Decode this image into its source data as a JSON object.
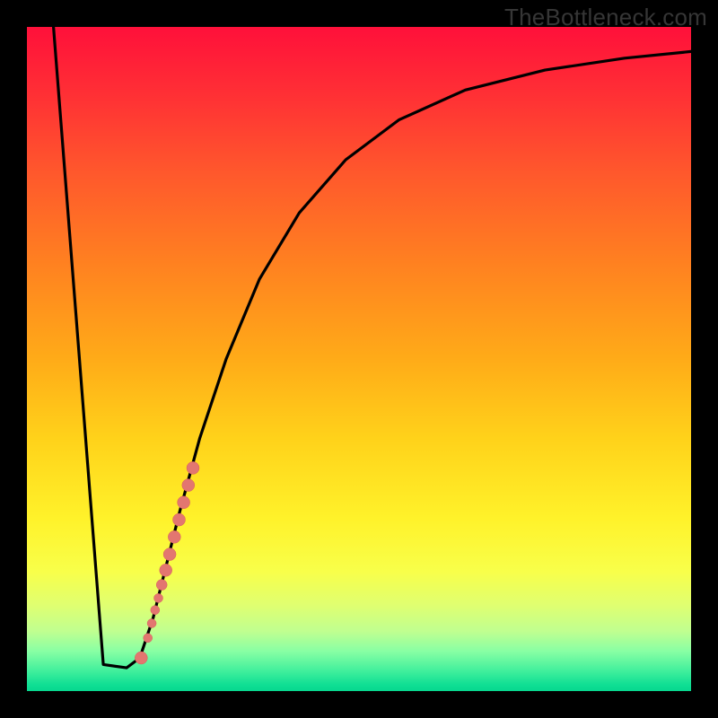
{
  "watermark": "TheBottleneck.com",
  "chart_data": {
    "type": "line",
    "title": "",
    "xlabel": "",
    "ylabel": "",
    "xlim": [
      0,
      100
    ],
    "ylim": [
      0,
      100
    ],
    "grid": false,
    "curve": [
      {
        "x": 4,
        "y": 100
      },
      {
        "x": 11.5,
        "y": 4
      },
      {
        "x": 15,
        "y": 3.5
      },
      {
        "x": 17,
        "y": 5
      },
      {
        "x": 19,
        "y": 11
      },
      {
        "x": 21,
        "y": 19
      },
      {
        "x": 23,
        "y": 27
      },
      {
        "x": 26,
        "y": 38
      },
      {
        "x": 30,
        "y": 50
      },
      {
        "x": 35,
        "y": 62
      },
      {
        "x": 41,
        "y": 72
      },
      {
        "x": 48,
        "y": 80
      },
      {
        "x": 56,
        "y": 86
      },
      {
        "x": 66,
        "y": 90.5
      },
      {
        "x": 78,
        "y": 93.5
      },
      {
        "x": 90,
        "y": 95.3
      },
      {
        "x": 100,
        "y": 96.3
      }
    ],
    "dots": [
      {
        "x": 17.2,
        "y": 5.0,
        "r": 7
      },
      {
        "x": 18.2,
        "y": 8.0,
        "r": 5
      },
      {
        "x": 18.8,
        "y": 10.2,
        "r": 5
      },
      {
        "x": 19.3,
        "y": 12.2,
        "r": 5
      },
      {
        "x": 19.8,
        "y": 14.0,
        "r": 5
      },
      {
        "x": 20.3,
        "y": 16.0,
        "r": 6
      },
      {
        "x": 20.9,
        "y": 18.2,
        "r": 7
      },
      {
        "x": 21.5,
        "y": 20.6,
        "r": 7
      },
      {
        "x": 22.2,
        "y": 23.2,
        "r": 7
      },
      {
        "x": 22.9,
        "y": 25.8,
        "r": 7
      },
      {
        "x": 23.6,
        "y": 28.4,
        "r": 7
      },
      {
        "x": 24.3,
        "y": 31.0,
        "r": 7
      },
      {
        "x": 25.0,
        "y": 33.6,
        "r": 7
      }
    ]
  }
}
